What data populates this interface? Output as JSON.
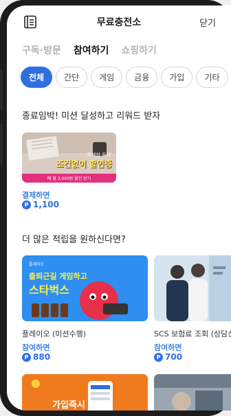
{
  "header": {
    "menu_icon": "menu-list-icon",
    "title": "무료충전소",
    "close_label": "닫기"
  },
  "main_tabs": [
    {
      "label": "구독·방문",
      "active": false
    },
    {
      "label": "참여하기",
      "active": true
    },
    {
      "label": "쇼핑하기",
      "active": false
    }
  ],
  "categories": [
    {
      "label": "전체",
      "active": true
    },
    {
      "label": "간단",
      "active": false
    },
    {
      "label": "게임",
      "active": false
    },
    {
      "label": "금융",
      "active": false
    },
    {
      "label": "가입",
      "active": false
    },
    {
      "label": "기타",
      "active": false
    }
  ],
  "sections": {
    "deadline_title": "종료임박! 미션 달성하고 리워드 받자",
    "more_title": "더 많은 적립을 원하신다면?"
  },
  "deadline_offer": {
    "banner_line1": "무제한 독서",
    "banner_line2": "조건없이 할인중",
    "banner_line3": "매 월 3,000원 할인 받기",
    "action": "결제하면",
    "reward": "1,100"
  },
  "offers": [
    {
      "name": "플레이오 (미션수행)",
      "action": "참여하면",
      "reward": "880",
      "banner_line1": "플레이오",
      "banner_line2": "출퇴근길 게임하고",
      "banner_line3": "스타벅스"
    },
    {
      "name": "SCS 보험료 조회 (상담신",
      "action": "참여하면",
      "reward": "700"
    }
  ],
  "bottom_offers": [
    {
      "banner_text": "가입즉시"
    },
    {
      "banner_text": ""
    }
  ],
  "coin_symbol": "P",
  "colors": {
    "accent": "#2f6fe0",
    "reward_text": "#3b82e6",
    "inactive_tab": "#b5b5b5"
  }
}
